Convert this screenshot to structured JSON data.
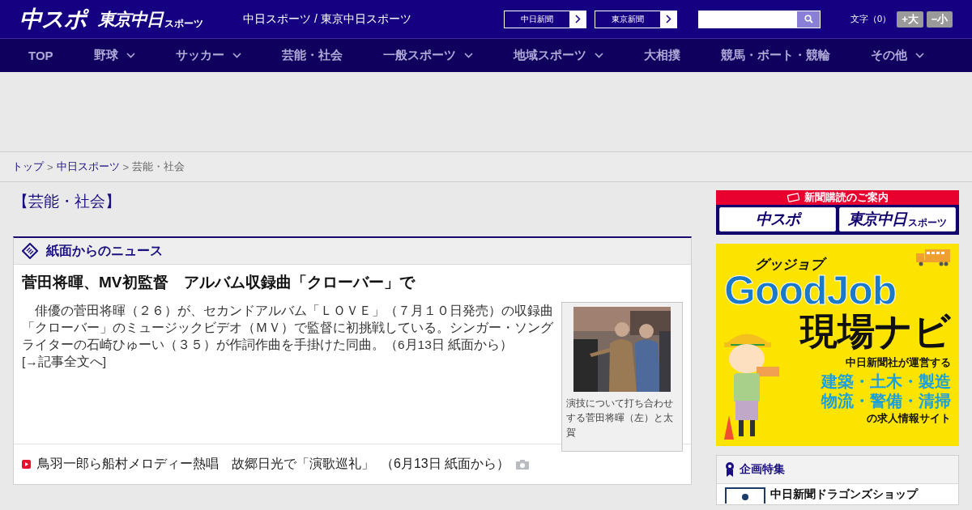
{
  "header": {
    "logo": "中スポ",
    "logo_sub": {
      "main": "東京中日",
      "small": "スポーツ"
    },
    "site_title": "中日スポーツ / 東京中日スポーツ",
    "paper_links": [
      "中日新聞",
      "東京新聞"
    ],
    "font_size": {
      "label": "文字（0）",
      "buttons": [
        "+大",
        "−小"
      ]
    }
  },
  "nav": [
    {
      "label": "TOP",
      "has_dropdown": false
    },
    {
      "label": "野球",
      "has_dropdown": true
    },
    {
      "label": "サッカー",
      "has_dropdown": true
    },
    {
      "label": "芸能・社会",
      "has_dropdown": false
    },
    {
      "label": "一般スポーツ",
      "has_dropdown": true
    },
    {
      "label": "地域スポーツ",
      "has_dropdown": true
    },
    {
      "label": "大相撲",
      "has_dropdown": false
    },
    {
      "label": "競馬・ボート・競輪",
      "has_dropdown": false
    },
    {
      "label": "その他",
      "has_dropdown": true
    }
  ],
  "breadcrumb": [
    {
      "label": "トップ",
      "kind": "link"
    },
    {
      "label": ">",
      "kind": "separator"
    },
    {
      "label": "中日スポーツ",
      "kind": "link"
    },
    {
      "label": ">",
      "kind": "separator"
    },
    {
      "label": "芸能・社会",
      "kind": "current"
    }
  ],
  "page_heading": "【芸能・社会】",
  "section": {
    "title": "紙面からのニュース",
    "lead": {
      "headline": "菅田将暉、MV初監督　アルバム収録曲「クローバー」で",
      "body": "　俳優の菅田将暉（２６）が、セカンドアルバム「ＬＯＶＥ」（７月１０日発売）の収録曲「クローバー」のミュージックビデオ（ＭＶ）で監督に初挑戦している。シンガー・ソングライターの石崎ひゅーい（３５）が作詞作曲を手掛けた同曲。（6月13日 紙面から）　",
      "more_link": "[→記事全文へ]",
      "photo": {
        "kind": "picture",
        "caption": "演技について打ち合わせする菅田将暉（左）と太賀"
      }
    },
    "items": [
      {
        "title": "鳥羽一郎ら船村メロディー熱唱　故郷日光で「演歌巡礼」",
        "date": "（6月13日 紙面から）",
        "has_photo": true
      }
    ]
  },
  "sidebar": {
    "subscribe": {
      "title": "新聞購読のご案内",
      "logos": [
        {
          "main": "中スポ"
        },
        {
          "main": "東京中日",
          "small": "スポーツ"
        }
      ]
    },
    "ad": {
      "kana": "グッジョブ",
      "brand": "GoodJob",
      "name": "現場ナビ",
      "tagline": "中日新聞社が運営する",
      "jobs": [
        "建築・土木・製造",
        "物流・警備・清掃"
      ],
      "footer": "の求人情報サイト"
    },
    "feature": {
      "title": "企画特集",
      "items": [
        "中日新聞ドラゴンズショップ"
      ]
    }
  }
}
